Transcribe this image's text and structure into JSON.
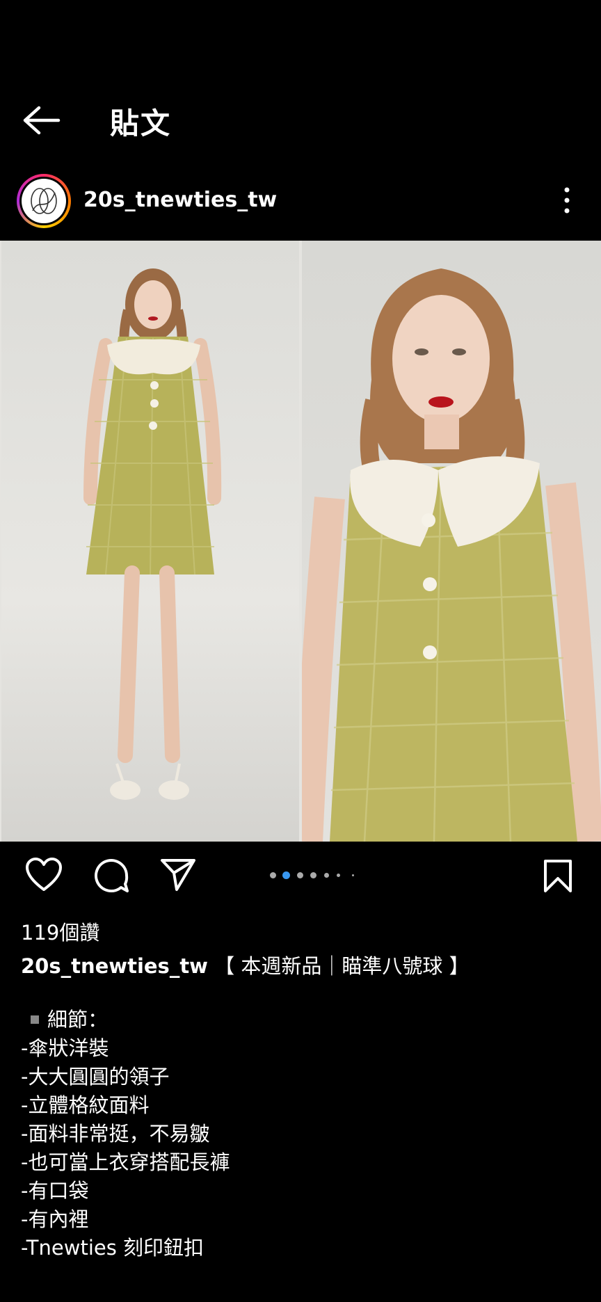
{
  "header": {
    "title": "貼文"
  },
  "post": {
    "username": "20s_tnewties_tw",
    "likes": "119個讚",
    "caption_user": "20s_tnewties_tw",
    "caption_headline": "【 本週新品｜瞄準八號球 】",
    "detail_heading": "細節：",
    "detail_lines": [
      "-傘狀洋裝",
      "-大大圓圓的領子",
      "-立體格紋面料",
      "-面料非常挺，不易皺",
      "-也可當上衣穿搭配長褲",
      "-有口袋",
      "-有內裡",
      "-Tnewties 刻印鈕扣"
    ]
  },
  "carousel": {
    "count": 6,
    "active_index": 1
  },
  "icons": {
    "back": "arrow-left-icon",
    "more": "more-vertical-icon",
    "like": "heart-icon",
    "comment": "comment-icon",
    "share": "send-icon",
    "save": "bookmark-icon"
  },
  "colors": {
    "background": "#000000",
    "text": "#ffffff",
    "active_dot": "#3897f0"
  }
}
